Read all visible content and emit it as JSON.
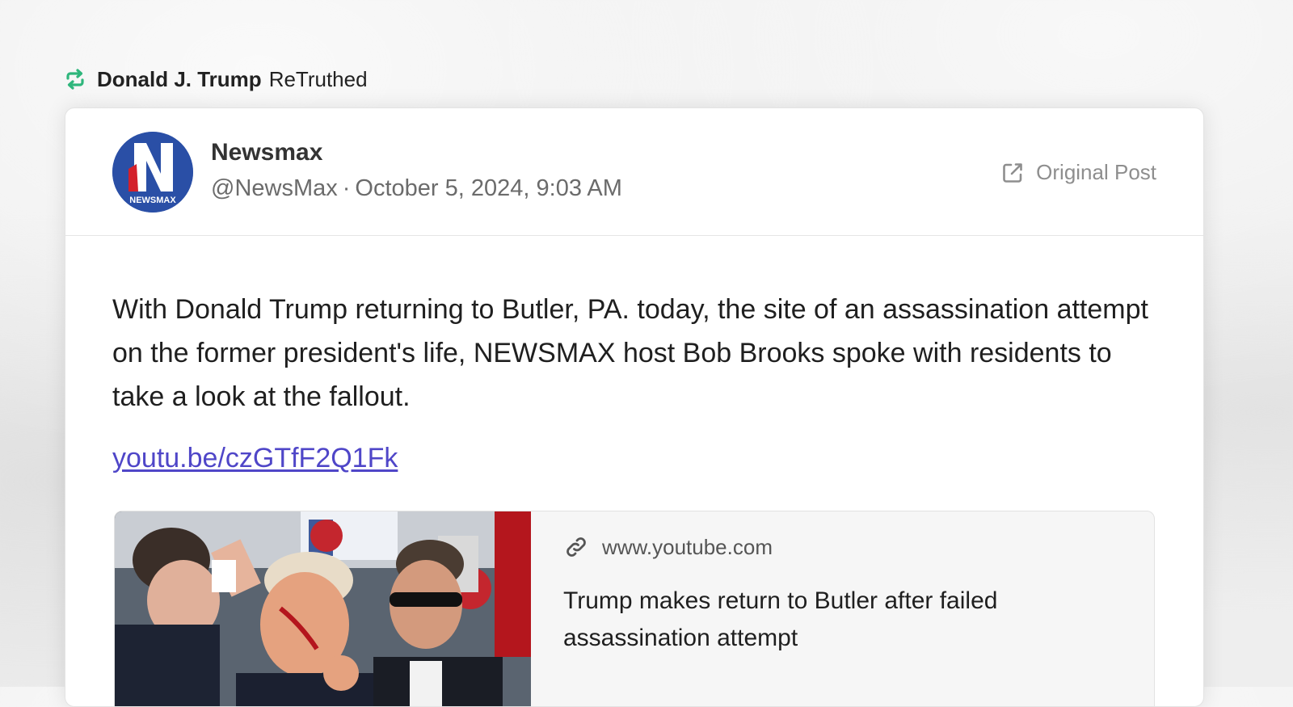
{
  "retruth": {
    "user_name": "Donald J. Trump",
    "action_label": "ReTruthed",
    "icon": "retruth-icon",
    "icon_color": "#2fb67c"
  },
  "post": {
    "account_name": "Newsmax",
    "handle": "@NewsMax",
    "separator": "·",
    "timestamp": "October 5, 2024, 9:03 AM",
    "avatar_text": "NEWSMAX",
    "original_post_label": "Original Post",
    "body_text": "With Donald Trump returning to Butler, PA. today, the site of an assassination attempt on the former president's life, NEWSMAX host Bob Brooks spoke with residents to take a look at the fallout.",
    "link_text": "youtu.be/czGTfF2Q1Fk",
    "link_color": "#4f46c8"
  },
  "preview": {
    "domain": "www.youtube.com",
    "title": "Trump makes return to Butler after failed assassination attempt"
  }
}
